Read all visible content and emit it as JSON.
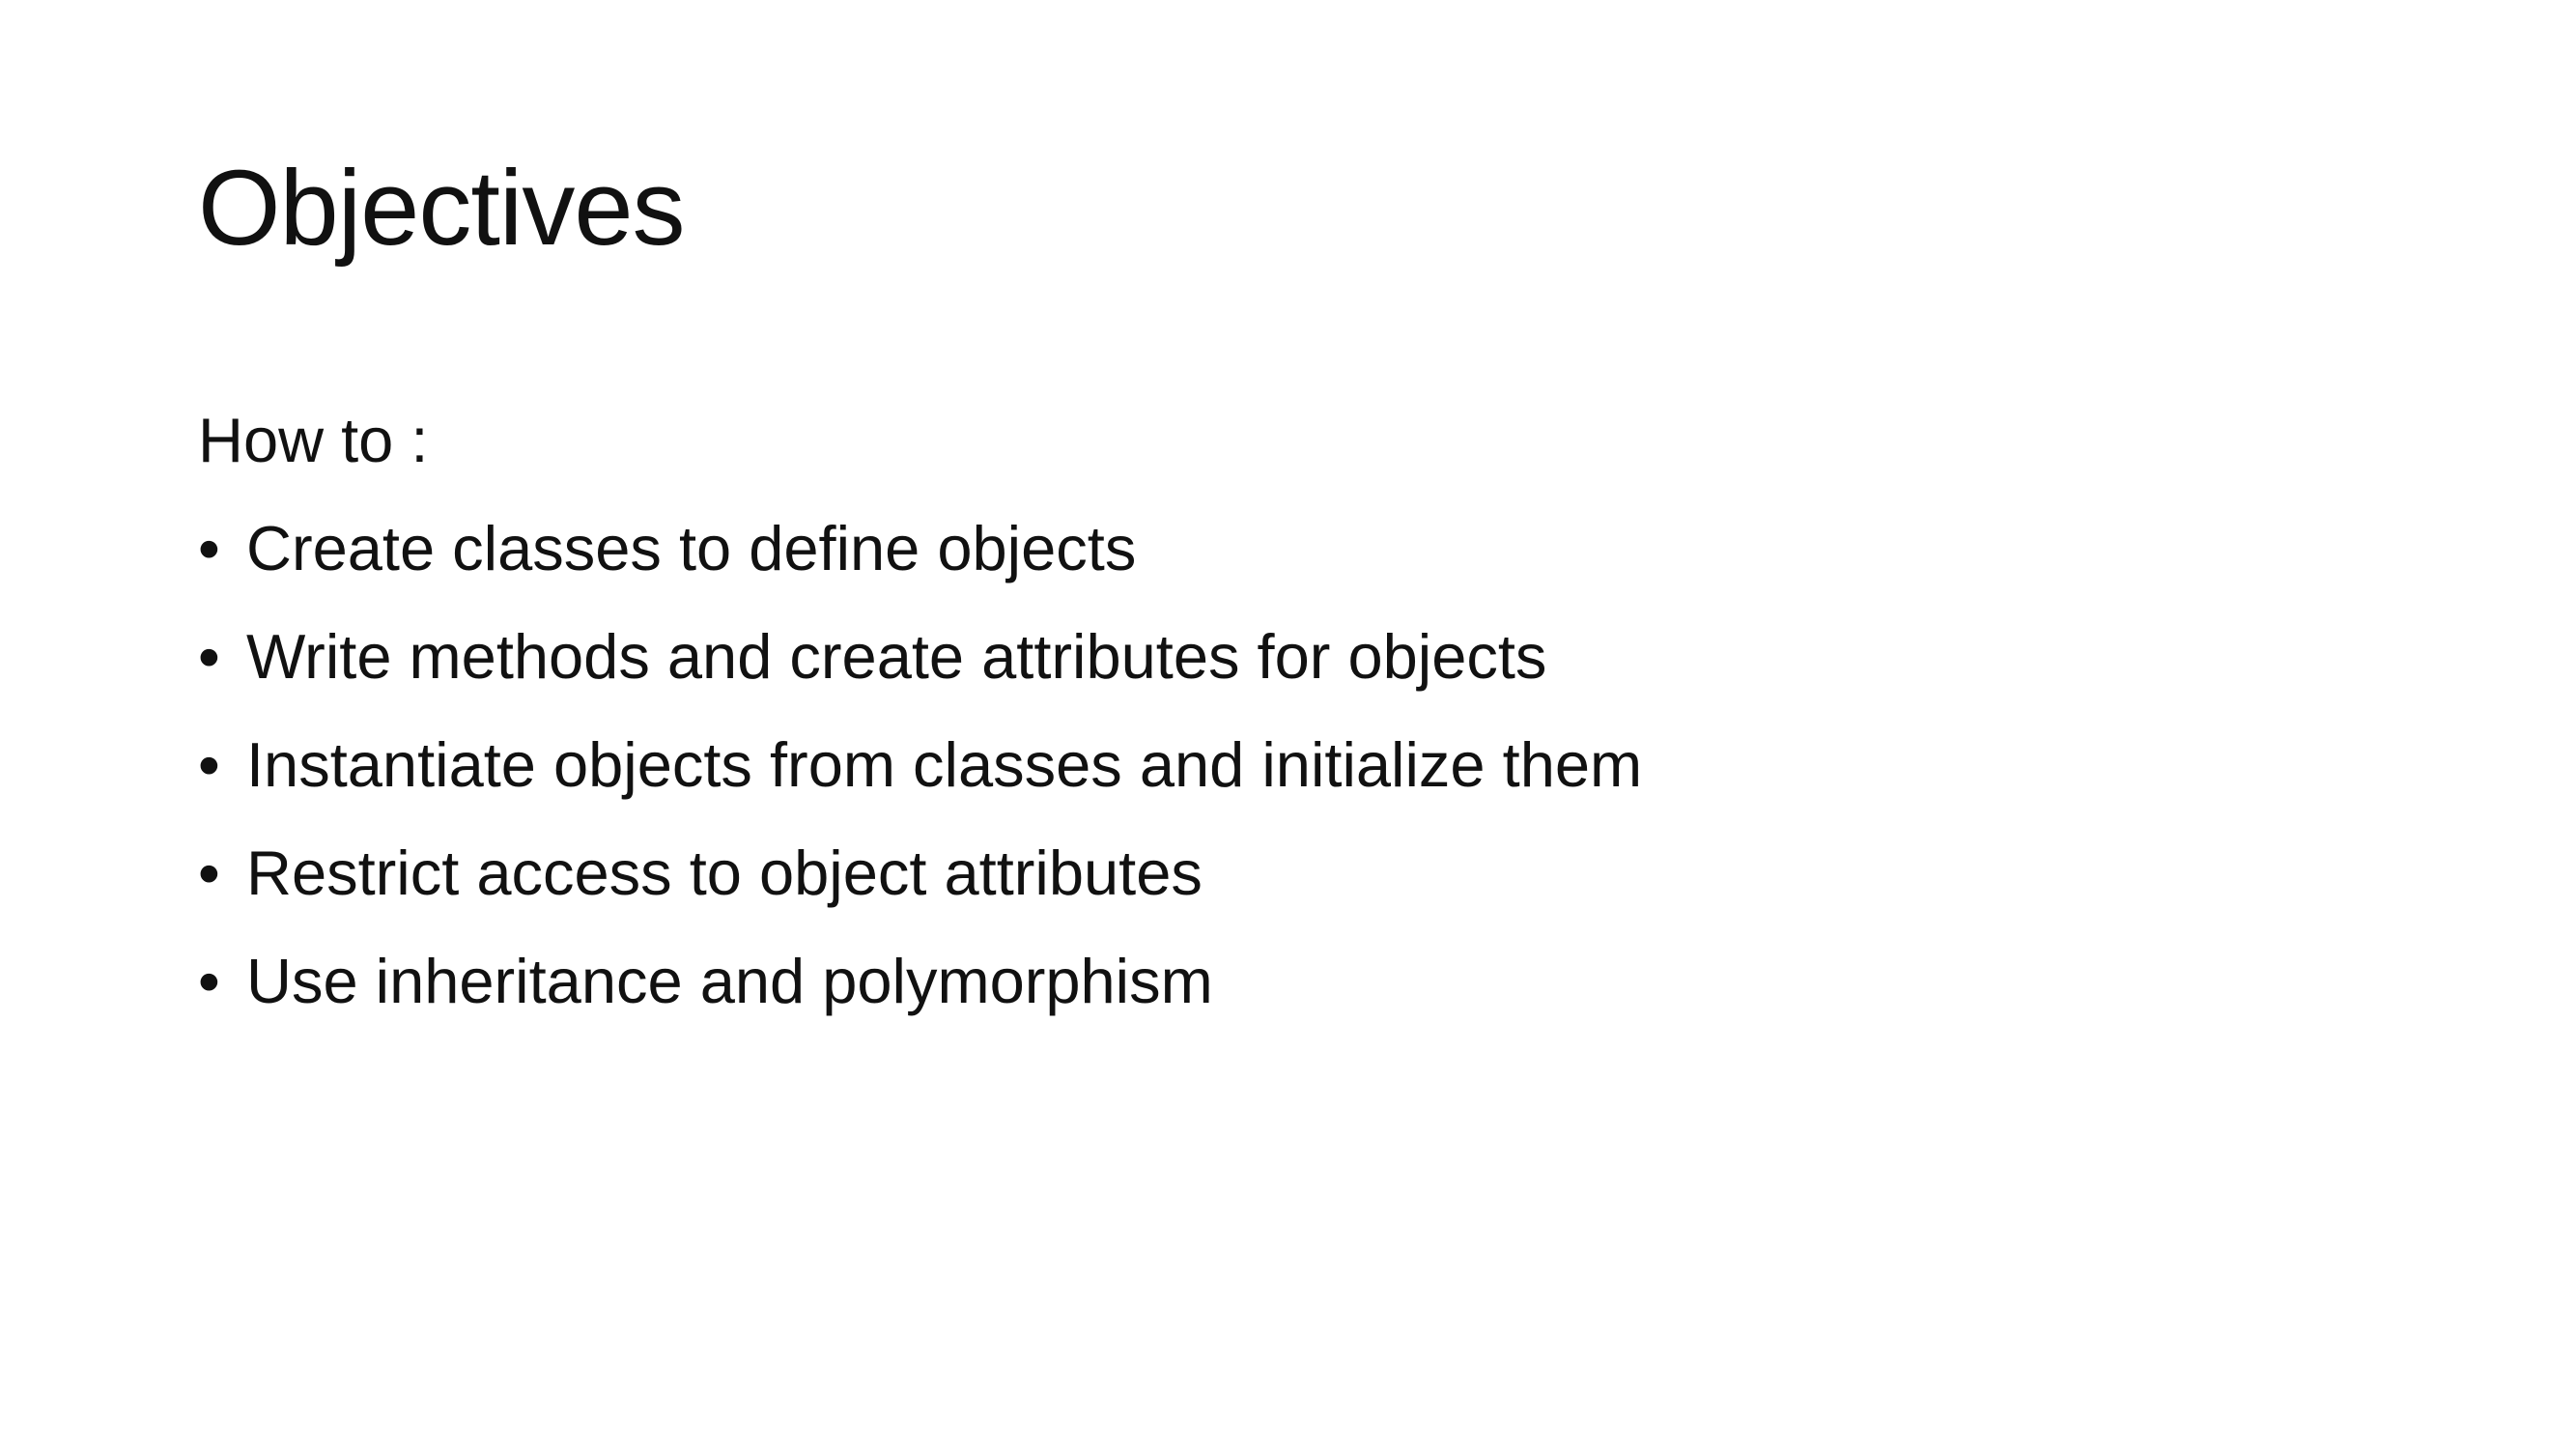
{
  "slide": {
    "title": "Objectives",
    "intro": "How to :",
    "bullet_glyph": "•",
    "bullets": [
      "Create classes to define objects",
      "Write methods and create attributes for objects",
      "Instantiate objects from classes and initialize them",
      "Restrict access to object attributes",
      "Use inheritance and polymorphism"
    ]
  }
}
